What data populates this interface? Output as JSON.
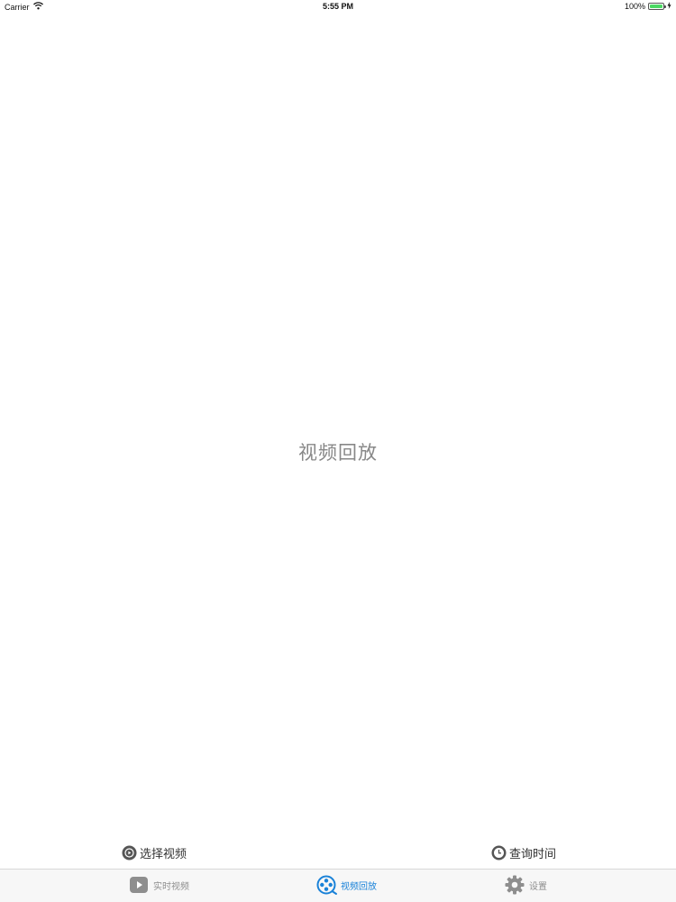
{
  "status_bar": {
    "carrier": "Carrier",
    "time": "5:55 PM",
    "battery_percent": "100%",
    "battery_level": 1.0,
    "battery_color": "#4cd964"
  },
  "main": {
    "title": "视频回放"
  },
  "actions": {
    "select_video": {
      "label": "选择视频",
      "icon": "play-circle-icon"
    },
    "query_time": {
      "label": "查询时间",
      "icon": "clock-icon"
    }
  },
  "tab_bar": {
    "active_color": "#1a82d8",
    "inactive_color": "#8e8e8e",
    "tabs": [
      {
        "label": "实时视频",
        "icon": "play-square-icon",
        "active": false
      },
      {
        "label": "视频回放",
        "icon": "film-reel-icon",
        "active": true
      },
      {
        "label": "设置",
        "icon": "gear-icon",
        "active": false
      }
    ]
  }
}
